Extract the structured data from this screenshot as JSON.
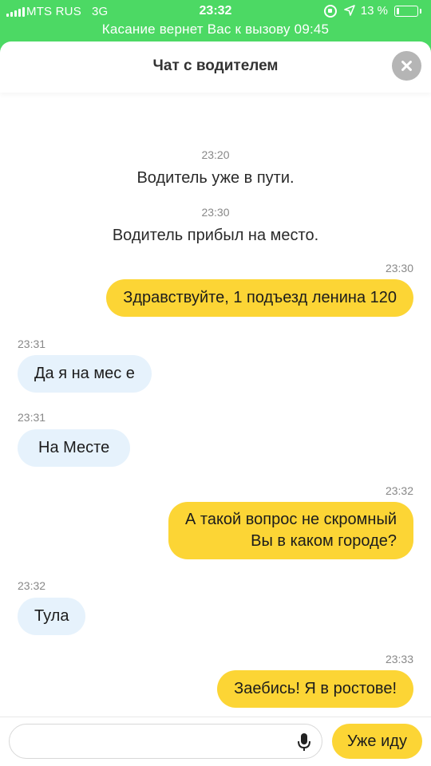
{
  "status_bar": {
    "carrier": "MTS RUS",
    "network": "3G",
    "time": "23:32",
    "battery_percent_label": "13 %",
    "battery_level": 0.13
  },
  "call_banner": "Касание вернет Вас к вызову 09:45",
  "header": {
    "title": "Чат с водителем",
    "close_icon": "close-icon"
  },
  "messages": [
    {
      "type": "system",
      "time": "23:20",
      "text": "Водитель уже в пути."
    },
    {
      "type": "system",
      "time": "23:30",
      "text": "Водитель прибыл на место."
    },
    {
      "type": "outgoing",
      "time": "23:30",
      "text": "Здравствуйте, 1 подъезд ленина 120"
    },
    {
      "type": "incoming",
      "time": "23:31",
      "text": "Да я на мес е"
    },
    {
      "type": "incoming",
      "time": "23:31",
      "text": "На Месте"
    },
    {
      "type": "outgoing",
      "time": "23:32",
      "line1": "А такой вопрос не скромный",
      "line2": "Вы в каком городе?"
    },
    {
      "type": "incoming",
      "time": "23:32",
      "text": "Тула"
    },
    {
      "type": "outgoing",
      "time": "23:33",
      "text": "Заебись! Я в ростове!"
    }
  ],
  "input": {
    "value": "",
    "placeholder": "",
    "mic_icon": "microphone-icon",
    "send_label": "Уже иду"
  },
  "colors": {
    "status_green": "#4cd964",
    "outgoing_bubble": "#fcd535",
    "incoming_bubble": "#e6f2fc"
  }
}
